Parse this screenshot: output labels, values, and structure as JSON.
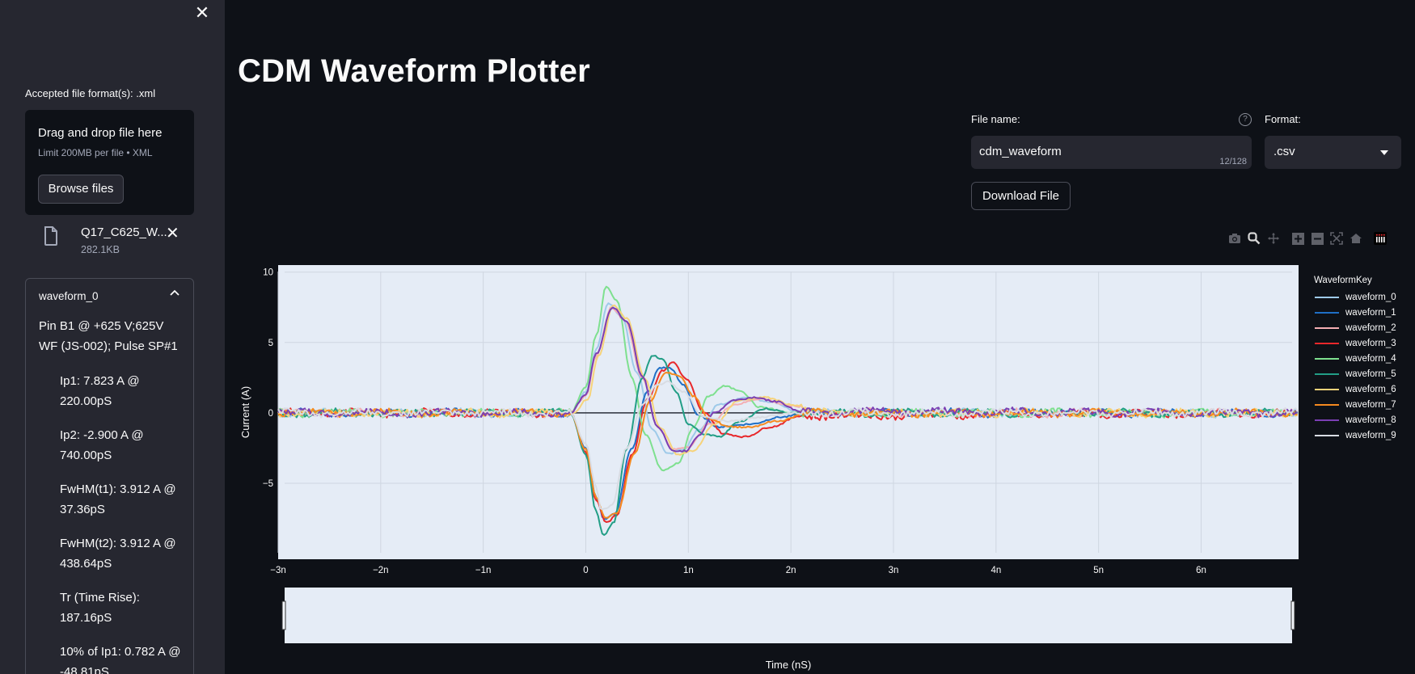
{
  "sidebar": {
    "close_icon": "close-icon",
    "accepted_formats": "Accepted file format(s): .xml",
    "dropzone": {
      "title": "Drag and drop file here",
      "limit": "Limit 200MB per file • XML",
      "browse_label": "Browse files"
    },
    "uploaded_file": {
      "icon": "file-icon",
      "name": "Q17_C625_W...",
      "size": "282.1KB"
    },
    "expander": {
      "title": "waveform_0",
      "description": "Pin B1 @ +625 V;625V WF (JS-002); Pulse SP#1",
      "metrics": [
        "Ip1: 7.823 A @ 220.00pS",
        "Ip2: -2.900 A @ 740.00pS",
        "FwHM(t1): 3.912 A @ 37.36pS",
        "FwHM(t2): 3.912 A @ 438.64pS",
        "Tr (Time Rise): 187.16pS",
        "10% of Ip1: 0.782 A @ -48.81pS"
      ]
    }
  },
  "main": {
    "title": "CDM Waveform Plotter",
    "file_name_label": "File name:",
    "file_name_value": "cdm_waveform",
    "file_name_count": "12/128",
    "format_label": "Format:",
    "format_value": ".csv",
    "download_label": "Download File",
    "help_icon": "?"
  },
  "modebar": [
    "camera-icon",
    "zoom-icon",
    "pan-icon",
    "zoom-in-icon",
    "zoom-out-icon",
    "autoscale-icon",
    "home-icon",
    "plotly-logo-icon"
  ],
  "chart_data": {
    "type": "line",
    "title": "",
    "xlabel": "Time (nS)",
    "ylabel": "Current (A)",
    "xlim": [
      -3.0,
      6.95
    ],
    "ylim": [
      -10.4,
      10.5
    ],
    "x_ticks": [
      -3,
      -2,
      -1,
      0,
      1,
      2,
      3,
      4,
      5,
      6
    ],
    "x_tick_labels": [
      "−3n",
      "−2n",
      "−1n",
      "0",
      "1n",
      "2n",
      "3n",
      "4n",
      "5n",
      "6n"
    ],
    "y_ticks": [
      -5,
      0,
      5,
      10
    ],
    "y_tick_labels": [
      "−5",
      "0",
      "5",
      "10"
    ],
    "grid": true,
    "legend_title": "WaveformKey",
    "legend_position": "right",
    "rangeslider": true,
    "zero_line": true,
    "series": [
      {
        "name": "waveform_0",
        "color": "#9ecae9",
        "x": [
          -3,
          -0.15,
          0.0,
          0.1,
          0.22,
          0.35,
          0.5,
          0.65,
          0.8,
          0.95,
          1.1,
          1.3,
          1.55,
          1.8,
          2.1,
          6.95
        ],
        "y": [
          0,
          0,
          1.5,
          4.5,
          7.8,
          6.8,
          2.8,
          -1.2,
          -2.9,
          -2.6,
          -1.2,
          0.6,
          1.1,
          0.8,
          0,
          0
        ]
      },
      {
        "name": "waveform_1",
        "color": "#1f6fc6",
        "x": [
          -3,
          -0.15,
          0.0,
          0.1,
          0.18,
          0.28,
          0.45,
          0.6,
          0.72,
          0.82,
          0.95,
          1.1,
          1.3,
          1.6,
          1.9,
          2.2,
          6.95
        ],
        "y": [
          0,
          0,
          -2.5,
          -6.0,
          -7.6,
          -7.2,
          -2.5,
          1.5,
          3.2,
          3.2,
          2.0,
          -0.2,
          -1.0,
          -0.8,
          -0.3,
          0,
          0
        ]
      },
      {
        "name": "waveform_2",
        "color": "#f4aeb3",
        "x": [
          -3,
          -0.15,
          0.0,
          0.1,
          0.25,
          0.38,
          0.55,
          0.7,
          0.85,
          1.0,
          1.2,
          1.45,
          1.7,
          2.0,
          2.3,
          6.95
        ],
        "y": [
          0,
          0,
          1.2,
          4.0,
          7.5,
          6.6,
          2.5,
          -1.0,
          -2.6,
          -2.4,
          -0.8,
          0.6,
          1.0,
          0.5,
          0,
          0
        ]
      },
      {
        "name": "waveform_3",
        "color": "#e8282b",
        "x": [
          -3,
          -0.15,
          0.0,
          0.1,
          0.2,
          0.3,
          0.45,
          0.6,
          0.75,
          0.85,
          0.98,
          1.15,
          1.35,
          1.55,
          1.8,
          2.1,
          6.95
        ],
        "y": [
          0,
          0,
          -2.8,
          -6.2,
          -7.8,
          -7.3,
          -3.0,
          1.0,
          3.0,
          3.6,
          2.4,
          0.0,
          -1.5,
          -1.7,
          -1.0,
          -0.2,
          0
        ]
      },
      {
        "name": "waveform_4",
        "color": "#7ee08f",
        "x": [
          -3,
          -0.15,
          0.0,
          0.1,
          0.2,
          0.3,
          0.45,
          0.58,
          0.75,
          0.9,
          1.05,
          1.2,
          1.35,
          1.5,
          1.7,
          2.0,
          6.95
        ],
        "y": [
          0,
          0,
          1.8,
          5.5,
          9.0,
          8.0,
          2.5,
          -1.5,
          -4.1,
          -3.6,
          -1.0,
          1.2,
          1.9,
          1.6,
          0.4,
          0,
          0
        ]
      },
      {
        "name": "waveform_5",
        "color": "#229e86",
        "x": [
          -3,
          -0.15,
          0.0,
          0.1,
          0.17,
          0.27,
          0.4,
          0.55,
          0.65,
          0.75,
          0.88,
          1.0,
          1.15,
          1.3,
          1.5,
          1.75,
          2.0,
          6.95
        ],
        "y": [
          0,
          0,
          -3.0,
          -7.0,
          -8.7,
          -7.8,
          -2.5,
          2.5,
          4.1,
          3.8,
          1.5,
          -0.8,
          -1.5,
          -1.7,
          -0.6,
          0.3,
          0,
          0
        ]
      },
      {
        "name": "waveform_6",
        "color": "#f6d37a",
        "x": [
          -3,
          -0.12,
          0.02,
          0.12,
          0.27,
          0.4,
          0.58,
          0.72,
          0.9,
          1.05,
          1.25,
          1.5,
          1.75,
          2.05,
          2.35,
          6.95
        ],
        "y": [
          0,
          0,
          1.0,
          4.0,
          7.6,
          6.7,
          2.4,
          -1.0,
          -3.0,
          -2.7,
          -0.8,
          0.9,
          1.1,
          0.5,
          0,
          0
        ]
      },
      {
        "name": "waveform_7",
        "color": "#f58a1f",
        "x": [
          -3,
          -0.15,
          0.0,
          0.1,
          0.19,
          0.3,
          0.48,
          0.62,
          0.78,
          0.92,
          1.05,
          1.2,
          1.4,
          1.6,
          1.85,
          2.2,
          6.95
        ],
        "y": [
          0,
          0,
          -2.6,
          -6.0,
          -7.5,
          -7.1,
          -2.8,
          0.8,
          2.9,
          2.6,
          1.2,
          -0.4,
          -1.0,
          -1.0,
          -0.6,
          0,
          0
        ]
      },
      {
        "name": "waveform_8",
        "color": "#7b3fb3",
        "x": [
          -3,
          -0.15,
          0.0,
          0.1,
          0.26,
          0.4,
          0.55,
          0.7,
          0.85,
          0.98,
          1.1,
          1.25,
          1.45,
          1.65,
          1.85,
          2.1,
          6.95
        ],
        "y": [
          0,
          0,
          1.3,
          4.2,
          7.5,
          6.5,
          2.6,
          -1.0,
          -2.7,
          -2.7,
          -1.6,
          0.0,
          0.9,
          1.1,
          0.8,
          0.1,
          0
        ]
      },
      {
        "name": "waveform_9",
        "color": "#d8dce3",
        "x": [
          -3,
          -0.15,
          0.0,
          0.1,
          0.15,
          0.25,
          0.4,
          0.55,
          0.7,
          0.8,
          0.95,
          1.15,
          1.4,
          1.7,
          2.0,
          6.95
        ],
        "y": [
          0,
          0,
          -2.2,
          -5.2,
          -6.9,
          -6.6,
          -2.5,
          0.6,
          2.0,
          2.2,
          1.5,
          -0.3,
          -0.6,
          -0.3,
          0,
          0
        ]
      }
    ]
  }
}
